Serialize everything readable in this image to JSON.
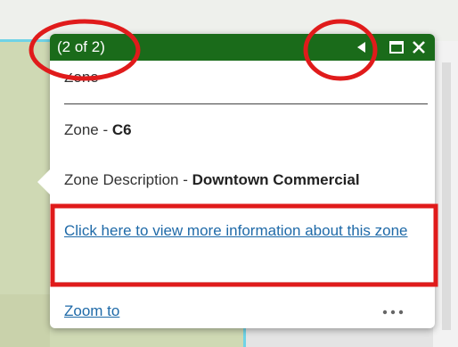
{
  "popup": {
    "header": {
      "count_label": "(2 of 2)",
      "prev_icon": "triangle-left-icon",
      "maximize_icon": "maximize-icon",
      "close_icon": "close-icon",
      "header_color": "#1a6b1a"
    },
    "title_partial": "Zone",
    "fields": [
      {
        "label": "Zone - ",
        "value": "C6"
      },
      {
        "label": "Zone Description - ",
        "value": "Downtown Commercial"
      }
    ],
    "info_link": "Click here to view more information about this zone",
    "footer": {
      "zoom_label": "Zoom to",
      "more_icon": "ellipsis-icon"
    }
  },
  "annotations": {
    "highlight_color": "#e01b1b",
    "shapes": [
      "circle-around-count",
      "circle-around-prev-button",
      "box-around-info-link"
    ]
  },
  "map": {
    "land_color": "#cfd9b4",
    "water_line_color": "#6fd3e6"
  }
}
